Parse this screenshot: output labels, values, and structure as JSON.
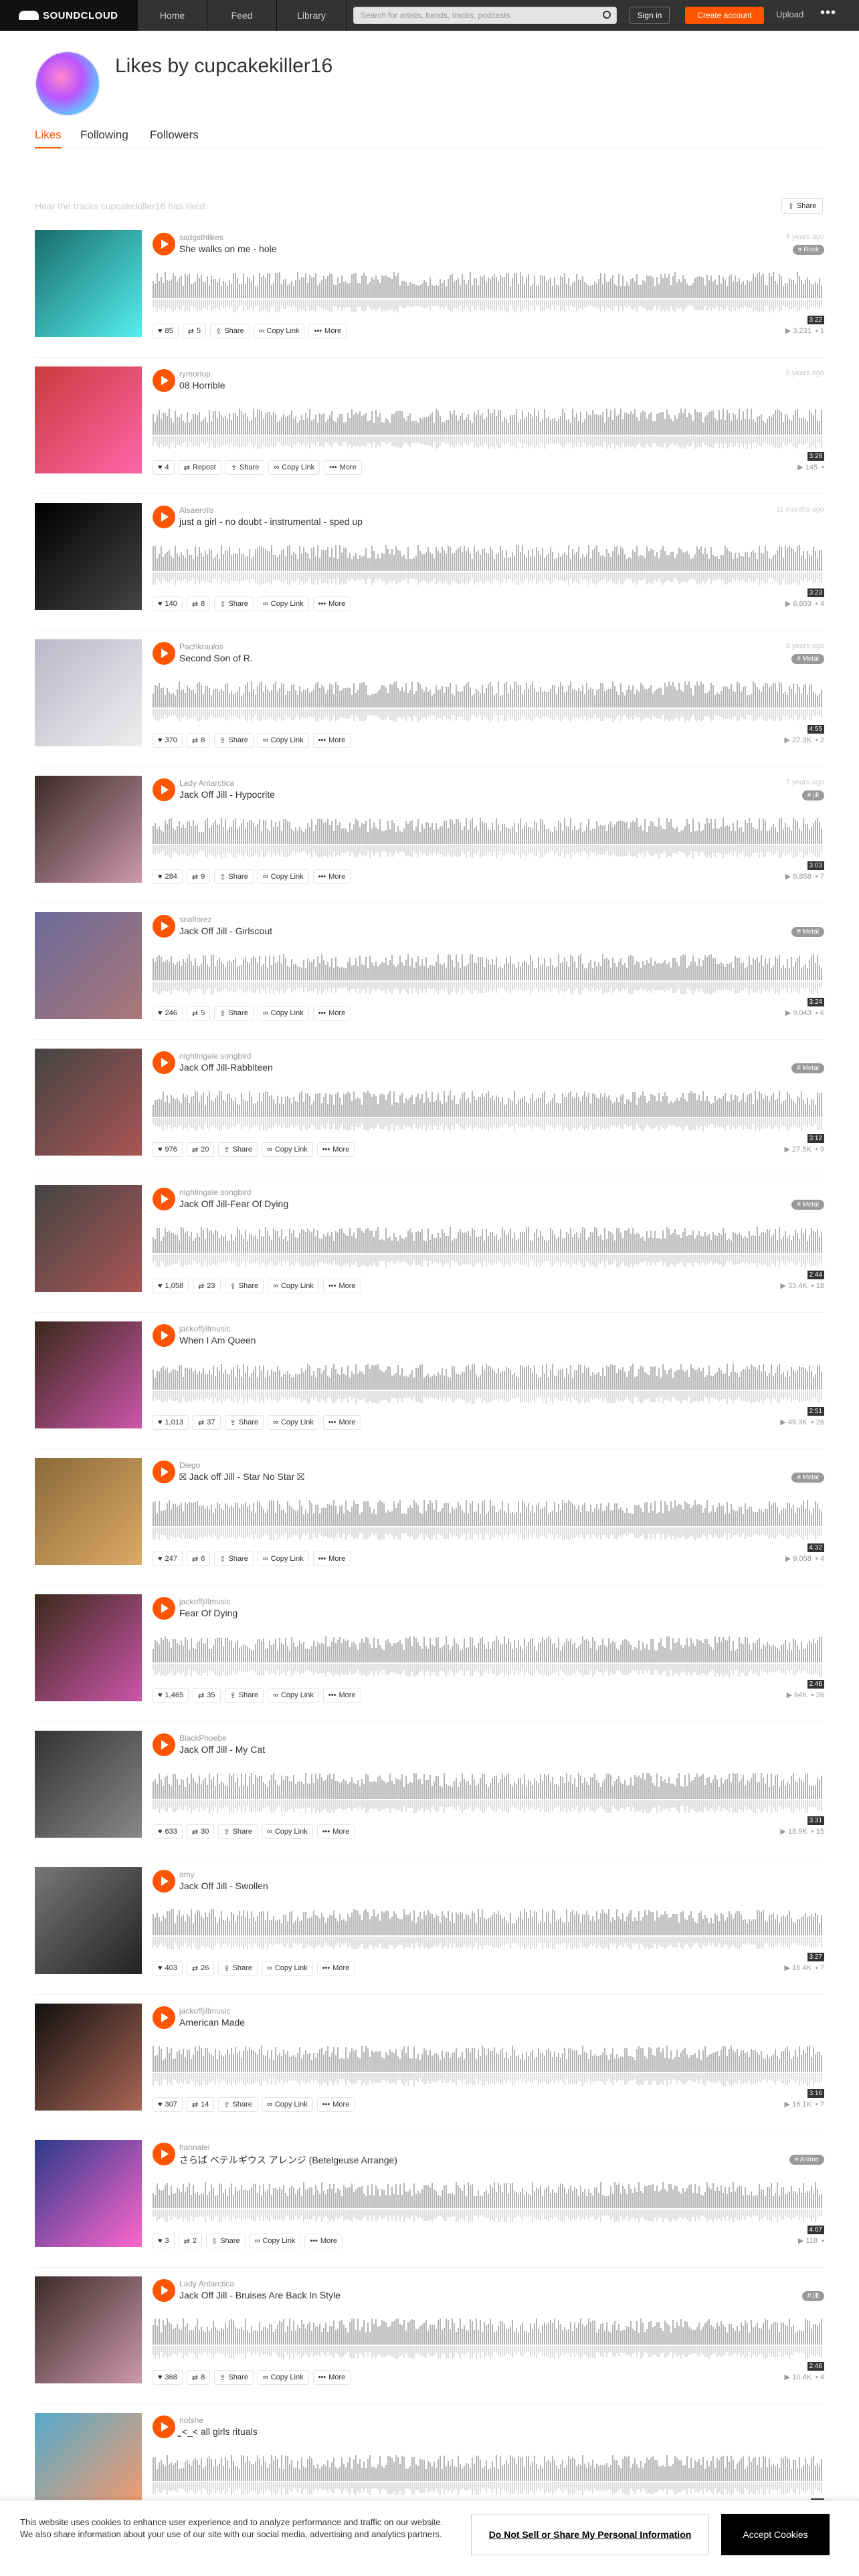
{
  "header": {
    "logo": "SOUNDCLOUD",
    "nav": [
      "Home",
      "Feed",
      "Library"
    ],
    "search_placeholder": "Search for artists, bands, tracks, podcasts",
    "signin": "Sign in",
    "create": "Create account",
    "upload": "Upload",
    "more": "•••"
  },
  "profile": {
    "title": "Likes by cupcakekiller16",
    "tabs": [
      "Likes",
      "Following",
      "Followers"
    ],
    "hear": "Hear the tracks cupcakekiller16 has liked:",
    "share": "Share"
  },
  "labels": {
    "share": "Share",
    "copy": "Copy Link",
    "more": "More",
    "repost": "Repost"
  },
  "tracks": [
    {
      "user": "sadgsthlikes",
      "title": "She walks on me - hole",
      "ago": "4 years ago",
      "tag": "# Rock",
      "dur": "3:22",
      "likes": "85",
      "reposts": "5",
      "plays": "3,231",
      "comments": "1",
      "color": "#1a6b6b",
      "color2": "#5ee"
    },
    {
      "user": "rymoriup",
      "title": "08 Horrible",
      "ago": "5 years ago",
      "tag": "",
      "dur": "3:28",
      "likes": "4",
      "reposts": "Repost",
      "plays": "145",
      "comments": "",
      "color": "#c83c3c",
      "color2": "#f6a"
    },
    {
      "user": "Alsaerolls",
      "title": "just a girl - no doubt - instrumental - sped up",
      "ago": "11 months ago",
      "tag": "",
      "dur": "3:23",
      "likes": "140",
      "reposts": "8",
      "plays": "6,603",
      "comments": "4",
      "color": "#000",
      "color2": "#444"
    },
    {
      "user": "Pachkraulos",
      "title": "Second Son of R.",
      "ago": "3 years ago",
      "tag": "# Metal",
      "dur": "4:55",
      "likes": "370",
      "reposts": "8",
      "plays": "22.3K",
      "comments": "2",
      "color": "#b8b8c8",
      "color2": "#eee"
    },
    {
      "user": "Lady Antarctica",
      "title": "Jack Off Jill - Hypocrite",
      "ago": "7 years ago",
      "tag": "# jill",
      "dur": "3:03",
      "likes": "284",
      "reposts": "9",
      "plays": "6,858",
      "comments": "7",
      "color": "#3a2a2a",
      "color2": "#c9a"
    },
    {
      "user": "snaflorez",
      "title": "Jack Off Jill - Girlscout",
      "ago": "",
      "tag": "# Metal",
      "dur": "3:24",
      "likes": "246",
      "reposts": "5",
      "plays": "9,043",
      "comments": "6",
      "color": "#6a6a9a",
      "color2": "#a77"
    },
    {
      "user": "nightingale.songbird",
      "title": "Jack Off Jill-Rabbiteen",
      "ago": "",
      "tag": "# Metal",
      "dur": "3:12",
      "likes": "976",
      "reposts": "20",
      "plays": "27.5K",
      "comments": "9",
      "color": "#444",
      "color2": "#a55"
    },
    {
      "user": "nightingale.songbird",
      "title": "Jack Off Jill-Fear Of Dying",
      "ago": "",
      "tag": "# Metal",
      "dur": "2:44",
      "likes": "1,058",
      "reposts": "23",
      "plays": "33.4K",
      "comments": "18",
      "color": "#444",
      "color2": "#a55"
    },
    {
      "user": "jackoffjillmusic",
      "title": "When I Am Queen",
      "ago": "",
      "tag": "",
      "dur": "2:51",
      "likes": "1,013",
      "reposts": "37",
      "plays": "49.3K",
      "comments": "26",
      "color": "#3a2a1a",
      "color2": "#c5a"
    },
    {
      "user": "Diego",
      "title": "⛝ Jack off Jill - Star No Star ⛝",
      "ago": "",
      "tag": "# Metal",
      "dur": "4:32",
      "likes": "247",
      "reposts": "6",
      "plays": "9,058",
      "comments": "4",
      "color": "#8a6a3a",
      "color2": "#da6"
    },
    {
      "user": "jackoffjillmusic",
      "title": "Fear Of Dying",
      "ago": "",
      "tag": "",
      "dur": "2:46",
      "likes": "1,465",
      "reposts": "35",
      "plays": "64K",
      "comments": "26",
      "color": "#3a2a1a",
      "color2": "#c5a"
    },
    {
      "user": "BlackPhoebe",
      "title": "Jack Off Jill - My Cat",
      "ago": "",
      "tag": "",
      "dur": "3:31",
      "likes": "633",
      "reposts": "30",
      "plays": "18.9K",
      "comments": "15",
      "color": "#333",
      "color2": "#888"
    },
    {
      "user": "amy",
      "title": "Jack Off Jill - Swollen",
      "ago": "",
      "tag": "",
      "dur": "3:27",
      "likes": "403",
      "reposts": "26",
      "plays": "16.4K",
      "comments": "7",
      "color": "#777",
      "color2": "#222"
    },
    {
      "user": "jackoffjillmusic",
      "title": "American Made",
      "ago": "",
      "tag": "",
      "dur": "3:16",
      "likes": "307",
      "reposts": "14",
      "plays": "16.1K",
      "comments": "7",
      "color": "#111",
      "color2": "#a65"
    },
    {
      "user": "hannalei",
      "title": "さらば ベテルギウス アレンジ (Betelgeuse Arrange)",
      "ago": "",
      "tag": "# Anime",
      "dur": "4:07",
      "likes": "3",
      "reposts": "2",
      "plays": "118",
      "comments": "",
      "color": "#2a3a8a",
      "color2": "#f6c"
    },
    {
      "user": "Lady Antarctica",
      "title": "Jack Off Jill - Bruises Are Back In Style",
      "ago": "",
      "tag": "# jill",
      "dur": "2:46",
      "likes": "368",
      "reposts": "8",
      "plays": "10.4K",
      "comments": "4",
      "color": "#3a2a2a",
      "color2": "#c9a"
    },
    {
      "user": "notshe",
      "title": "̳̳ <_< all girls rituals",
      "ago": "",
      "tag": "",
      "dur": "2:1",
      "likes": "",
      "reposts": "",
      "plays": "",
      "comments": "",
      "color": "#5ac",
      "color2": "#f96"
    }
  ],
  "cookie": {
    "text": "This website uses cookies to enhance user experience and to analyze performance and traffic on our website. We also share information about your use of our site with our social media, advertising and analytics partners.",
    "dns": "Do Not Sell or Share My Personal Information",
    "accept": "Accept Cookies"
  }
}
